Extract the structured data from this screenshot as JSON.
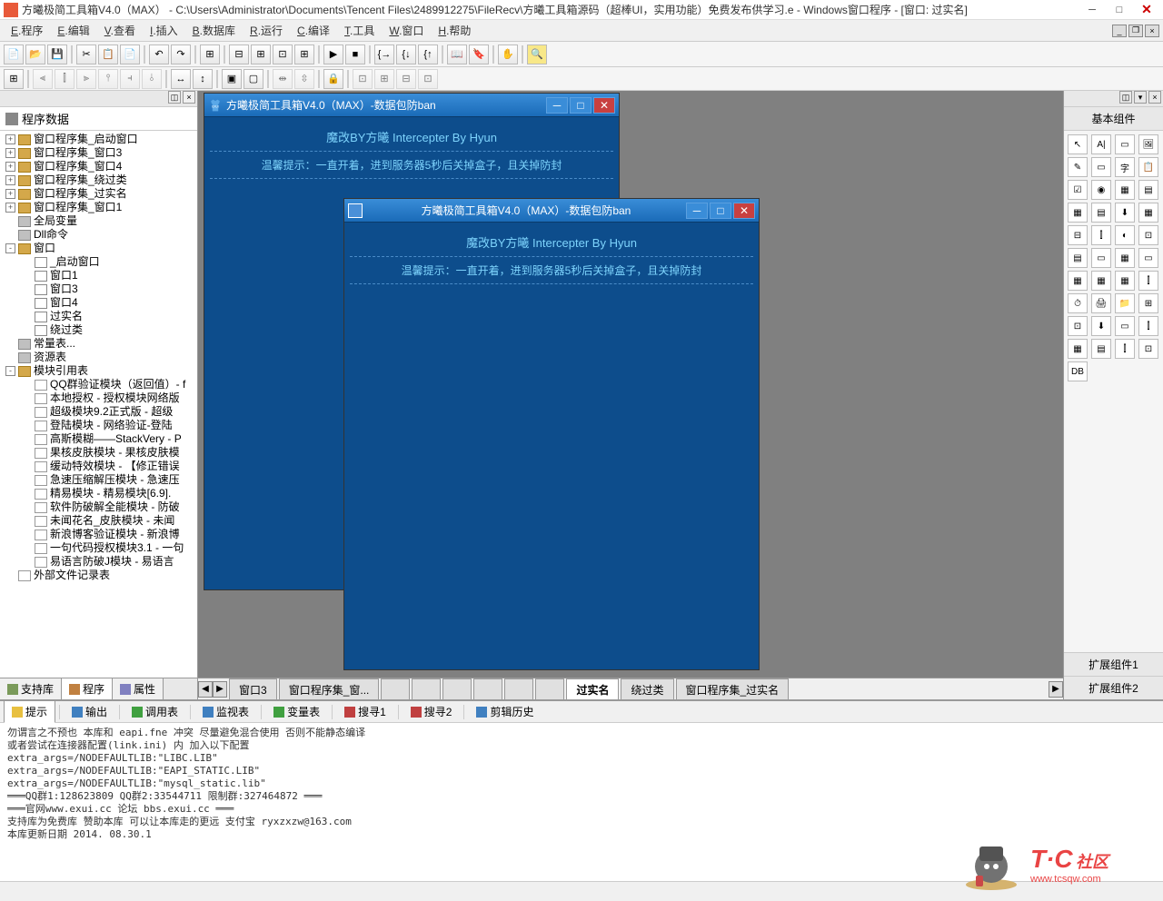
{
  "window": {
    "title": "方曦极简工具箱V4.0（MAX） - C:\\Users\\Administrator\\Documents\\Tencent Files\\2489912275\\FileRecv\\方曦工具箱源码（超棒UI，实用功能）免费发布供学习.e - Windows窗口程序 - [窗口: 过实名]"
  },
  "menu": {
    "items": [
      "E.程序",
      "E.编辑",
      "V.查看",
      "I.插入",
      "B.数据库",
      "R.运行",
      "C.编译",
      "T.工具",
      "W.窗口",
      "H.帮助"
    ]
  },
  "tree": {
    "title": "程序数据",
    "items": [
      {
        "l": 1,
        "exp": "+",
        "icon": "folder",
        "label": "窗口程序集_启动窗口"
      },
      {
        "l": 1,
        "exp": "+",
        "icon": "folder",
        "label": "窗口程序集_窗口3"
      },
      {
        "l": 1,
        "exp": "+",
        "icon": "folder",
        "label": "窗口程序集_窗口4"
      },
      {
        "l": 1,
        "exp": "+",
        "icon": "folder",
        "label": "窗口程序集_绕过类"
      },
      {
        "l": 1,
        "exp": "+",
        "icon": "folder",
        "label": "窗口程序集_过实名"
      },
      {
        "l": 1,
        "exp": "+",
        "icon": "folder",
        "label": "窗口程序集_窗口1"
      },
      {
        "l": 1,
        "exp": "",
        "icon": "mod",
        "label": "全局变量"
      },
      {
        "l": 1,
        "exp": "",
        "icon": "mod",
        "label": "Dll命令"
      },
      {
        "l": 1,
        "exp": "-",
        "icon": "folder",
        "label": "窗口"
      },
      {
        "l": 2,
        "exp": "",
        "icon": "win",
        "label": "_启动窗口"
      },
      {
        "l": 2,
        "exp": "",
        "icon": "win",
        "label": "窗口1"
      },
      {
        "l": 2,
        "exp": "",
        "icon": "win",
        "label": "窗口3"
      },
      {
        "l": 2,
        "exp": "",
        "icon": "win",
        "label": "窗口4"
      },
      {
        "l": 2,
        "exp": "",
        "icon": "win",
        "label": "过实名"
      },
      {
        "l": 2,
        "exp": "",
        "icon": "win",
        "label": "绕过类"
      },
      {
        "l": 1,
        "exp": "",
        "icon": "mod",
        "label": "常量表..."
      },
      {
        "l": 1,
        "exp": "",
        "icon": "mod",
        "label": "资源表"
      },
      {
        "l": 1,
        "exp": "-",
        "icon": "folder",
        "label": "模块引用表"
      },
      {
        "l": 2,
        "exp": "",
        "icon": "file",
        "label": "QQ群验证模块（返回值）- f"
      },
      {
        "l": 2,
        "exp": "",
        "icon": "file",
        "label": "本地授权 - 授权模块网络版"
      },
      {
        "l": 2,
        "exp": "",
        "icon": "file",
        "label": "超级模块9.2正式版 - 超级"
      },
      {
        "l": 2,
        "exp": "",
        "icon": "file",
        "label": "登陆模块 - 网络验证-登陆"
      },
      {
        "l": 2,
        "exp": "",
        "icon": "file",
        "label": "高斯模糊——StackVery - P"
      },
      {
        "l": 2,
        "exp": "",
        "icon": "file",
        "label": "果核皮肤模块 - 果核皮肤模"
      },
      {
        "l": 2,
        "exp": "",
        "icon": "file",
        "label": "缓动特效模块 - 【修正错误"
      },
      {
        "l": 2,
        "exp": "",
        "icon": "file",
        "label": "急速压缩解压模块 - 急速压"
      },
      {
        "l": 2,
        "exp": "",
        "icon": "file",
        "label": "精易模块 - 精易模块[6.9]."
      },
      {
        "l": 2,
        "exp": "",
        "icon": "file",
        "label": "软件防破解全能模块 - 防破"
      },
      {
        "l": 2,
        "exp": "",
        "icon": "file",
        "label": "未闻花名_皮肤模块 - 未闻"
      },
      {
        "l": 2,
        "exp": "",
        "icon": "file",
        "label": "新浪博客验证模块 - 新浪博"
      },
      {
        "l": 2,
        "exp": "",
        "icon": "file",
        "label": "一句代码授权模块3.1 - 一句"
      },
      {
        "l": 2,
        "exp": "",
        "icon": "file",
        "label": "易语言防破J模块 - 易语言"
      },
      {
        "l": 1,
        "exp": "",
        "icon": "file",
        "label": "外部文件记录表"
      }
    ]
  },
  "leftTabs": [
    {
      "label": "支持库"
    },
    {
      "label": "程序"
    },
    {
      "label": "属性"
    }
  ],
  "form1": {
    "title": "方曦极简工具箱V4.0（MAX）-数据包防ban",
    "subtitle": "魔改BY方曦   Intercepter By Hyun",
    "hint": "温馨提示：一直开着，进到服务器5秒后关掉盒子，且关掉防封"
  },
  "form2": {
    "title": "方曦极简工具箱V4.0（MAX）-数据包防ban",
    "subtitle": "魔改BY方曦   Intercepter By Hyun",
    "hint": "温馨提示：一直开着，进到服务器5秒后关掉盒子，且关掉防封"
  },
  "designTabs": [
    "窗口3",
    "窗口程序集_窗...",
    "",
    "",
    "",
    "",
    "",
    "",
    "过实名",
    "绕过类",
    "窗口程序集_过实名"
  ],
  "activeDesignTab": 8,
  "rightPanel": {
    "title": "基本组件",
    "ext1": "扩展组件1",
    "ext2": "扩展组件2"
  },
  "outputTabs": [
    "提示",
    "输出",
    "调用表",
    "监视表",
    "变量表",
    "搜寻1",
    "搜寻2",
    "剪辑历史"
  ],
  "outputText": "勿谓言之不预也 本库和 eapi.fne 冲突 尽量避免混合使用 否则不能静态编译\n或者尝试在连接器配置(link.ini) 内 加入以下配置\nextra_args=/NODEFAULTLIB:\"LIBC.LIB\"\nextra_args=/NODEFAULTLIB:\"EAPI_STATIC.LIB\"\nextra_args=/NODEFAULTLIB:\"mysql_static.lib\"\n═══QQ群1:128623809 QQ群2:33544711 限制群:327464872 ═══\n═══官网www.exui.cc 论坛 bbs.exui.cc ═══\n支持库为免费库 赞助本库 可以让本库走的更远 支付宝 ryxzxzw@163.com\n本库更新日期 2014. 08.30.1",
  "watermark": {
    "text": "T·C",
    "sub": "社区",
    "url": "www.tcsqw.com"
  }
}
